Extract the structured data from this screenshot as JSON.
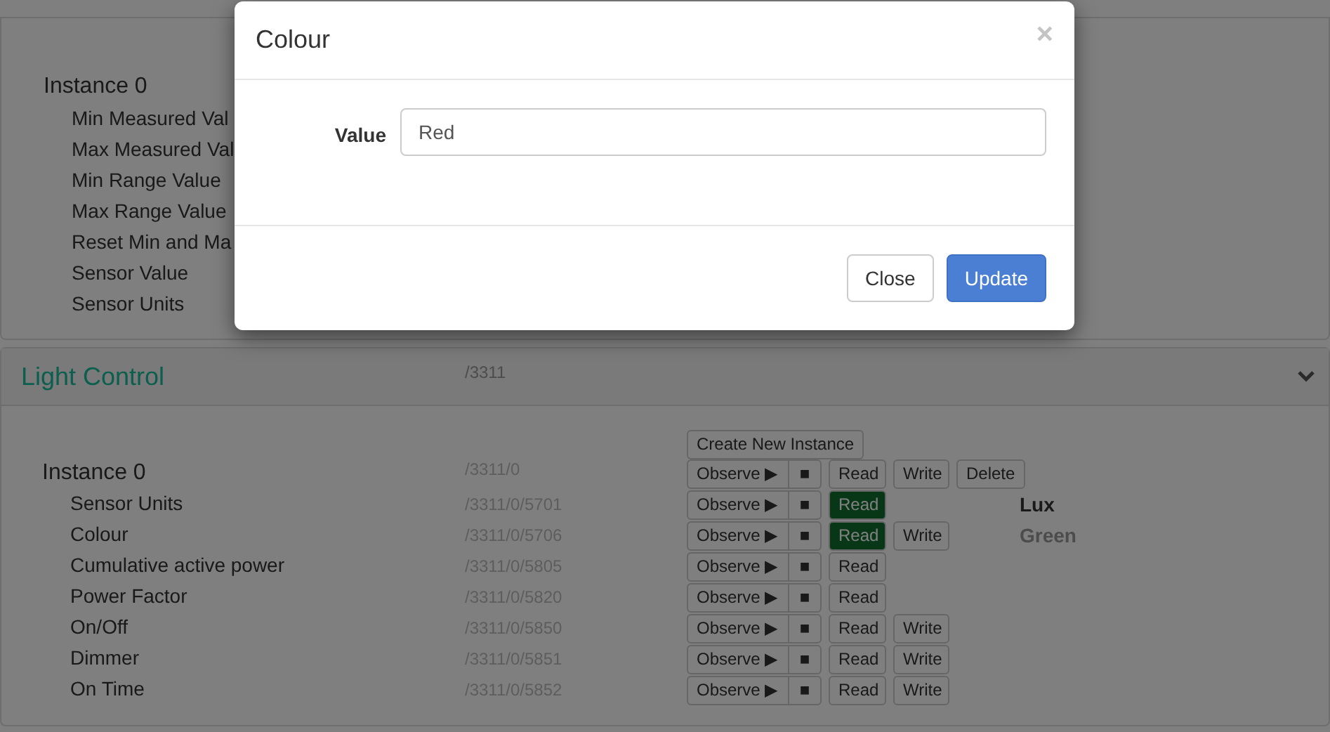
{
  "top_panel": {
    "instance": "Instance 0",
    "items": [
      "Min Measured Val",
      "Max Measured Val",
      "Min Range Value",
      "Max Range Value",
      "Reset Min and Ma",
      "Sensor Value",
      "Sensor Units"
    ]
  },
  "light_control": {
    "title": "Light Control",
    "path": "/3311",
    "create_button": "Create New Instance",
    "rows": [
      {
        "kind": "instance",
        "name": "Instance 0",
        "path": "/3311/0",
        "buttons": [
          {
            "kind": "observe",
            "label": "Observe ▶",
            "stop": "■"
          },
          {
            "kind": "read",
            "label": "Read",
            "highlighted": false
          },
          {
            "kind": "write",
            "label": "Write"
          },
          {
            "kind": "delete",
            "label": "Delete"
          }
        ]
      },
      {
        "kind": "resource",
        "name": "Sensor Units",
        "path": "/3311/0/5701",
        "buttons": [
          {
            "kind": "observe",
            "label": "Observe ▶",
            "stop": "■"
          },
          {
            "kind": "read",
            "label": "Read",
            "highlighted": true
          }
        ],
        "value": "Lux",
        "value_muted": false
      },
      {
        "kind": "resource",
        "name": "Colour",
        "path": "/3311/0/5706",
        "buttons": [
          {
            "kind": "observe",
            "label": "Observe ▶",
            "stop": "■"
          },
          {
            "kind": "read",
            "label": "Read",
            "highlighted": true
          },
          {
            "kind": "write",
            "label": "Write"
          }
        ],
        "value": "Green",
        "value_muted": true
      },
      {
        "kind": "resource",
        "name": "Cumulative active power",
        "path": "/3311/0/5805",
        "buttons": [
          {
            "kind": "observe",
            "label": "Observe ▶",
            "stop": "■"
          },
          {
            "kind": "read",
            "label": "Read",
            "highlighted": false
          }
        ]
      },
      {
        "kind": "resource",
        "name": "Power Factor",
        "path": "/3311/0/5820",
        "buttons": [
          {
            "kind": "observe",
            "label": "Observe ▶",
            "stop": "■"
          },
          {
            "kind": "read",
            "label": "Read",
            "highlighted": false
          }
        ]
      },
      {
        "kind": "resource",
        "name": "On/Off",
        "path": "/3311/0/5850",
        "buttons": [
          {
            "kind": "observe",
            "label": "Observe ▶",
            "stop": "■"
          },
          {
            "kind": "read",
            "label": "Read",
            "highlighted": false
          },
          {
            "kind": "write",
            "label": "Write"
          }
        ]
      },
      {
        "kind": "resource",
        "name": "Dimmer",
        "path": "/3311/0/5851",
        "buttons": [
          {
            "kind": "observe",
            "label": "Observe ▶",
            "stop": "■"
          },
          {
            "kind": "read",
            "label": "Read",
            "highlighted": false
          },
          {
            "kind": "write",
            "label": "Write"
          }
        ]
      },
      {
        "kind": "resource",
        "name": "On Time",
        "path": "/3311/0/5852",
        "buttons": [
          {
            "kind": "observe",
            "label": "Observe ▶",
            "stop": "■"
          },
          {
            "kind": "read",
            "label": "Read",
            "highlighted": false
          },
          {
            "kind": "write",
            "label": "Write"
          }
        ]
      }
    ]
  },
  "dialog": {
    "title": "Colour",
    "close_icon": "×",
    "field_label": "Value",
    "field_value": "Red",
    "buttons": [
      {
        "kind": "default",
        "label": "Close"
      },
      {
        "kind": "primary",
        "label": "Update"
      }
    ]
  }
}
